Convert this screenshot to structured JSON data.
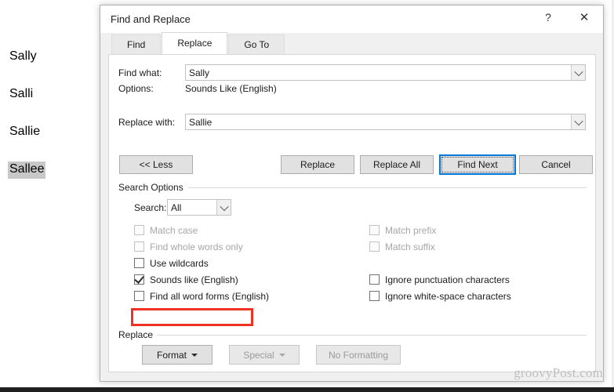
{
  "document": {
    "words": [
      {
        "text": "Sally",
        "selected": false
      },
      {
        "text": "Salli",
        "selected": false
      },
      {
        "text": "Sallie",
        "selected": false
      },
      {
        "text": "Sallee",
        "selected": true
      }
    ]
  },
  "dialog": {
    "title": "Find and Replace",
    "help_label": "?",
    "close_label": "✕",
    "tabs": [
      {
        "label": "Find",
        "accel": "d",
        "active": false
      },
      {
        "label": "Replace",
        "accel": "",
        "active": true
      },
      {
        "label": "Go To",
        "accel": "G",
        "active": false
      }
    ],
    "fields": {
      "find_label": "Find what:",
      "find_value": "Sally",
      "find_placeholder": "",
      "options_label": "Options:",
      "options_value": "Sounds Like (English)",
      "replace_label": "Replace with:",
      "replace_value": "Sallie",
      "replace_placeholder": ""
    },
    "buttons": {
      "less": "<< Less",
      "replace": "Replace",
      "replace_all": "Replace All",
      "find_next": "Find Next",
      "cancel": "Cancel"
    },
    "search_options": {
      "group_title": "Search Options",
      "search_label": "Search:",
      "search_value": "All",
      "left_checkboxes": [
        {
          "label": "Match case",
          "checked": false,
          "disabled": true,
          "accel": ""
        },
        {
          "label": "Find whole words only",
          "checked": false,
          "disabled": true,
          "accel": ""
        },
        {
          "label": "Use wildcards",
          "checked": false,
          "disabled": false,
          "accel": "U"
        },
        {
          "label": "Sounds like (English)",
          "checked": true,
          "disabled": false,
          "accel": "k"
        },
        {
          "label": "Find all word forms (English)",
          "checked": false,
          "disabled": false,
          "accel": "w"
        }
      ],
      "right_checkboxes": [
        {
          "label": "Match prefix",
          "checked": false,
          "disabled": true,
          "accel": ""
        },
        {
          "label": "Match suffix",
          "checked": false,
          "disabled": true,
          "accel": ""
        },
        {
          "label": "Ignore punctuation characters",
          "checked": false,
          "disabled": false,
          "accel": "s"
        },
        {
          "label": "Ignore white-space characters",
          "checked": false,
          "disabled": false,
          "accel": "w"
        }
      ],
      "highlight_color": "#ee3322",
      "highlighted_option": "Sounds like (English)"
    },
    "replace_group": {
      "group_title": "Replace",
      "format_label": "Format",
      "special_label": "Special",
      "no_formatting_label": "No Formatting"
    },
    "accent_color": "#0078d7"
  },
  "watermark": "groovyPost.com"
}
